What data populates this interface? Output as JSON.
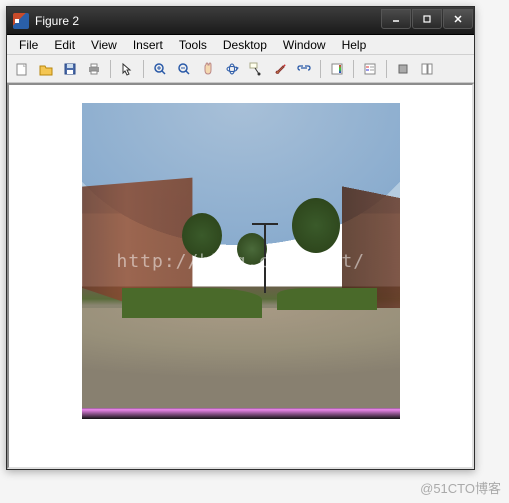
{
  "window": {
    "title": "Figure 2",
    "controls": {
      "minimize": "minimize",
      "maximize": "maximize",
      "close": "close"
    }
  },
  "menubar": {
    "items": [
      "File",
      "Edit",
      "View",
      "Insert",
      "Tools",
      "Desktop",
      "Window",
      "Help"
    ]
  },
  "toolbar": {
    "groups": [
      [
        "new-figure",
        "open",
        "save",
        "print"
      ],
      [
        "arrow"
      ],
      [
        "zoom-in",
        "zoom-out",
        "pan",
        "rotate3d",
        "data-cursor",
        "brush",
        "link"
      ],
      [
        "insert-colorbar",
        "insert-legend"
      ],
      [
        "hide-tools",
        "show-tools"
      ]
    ],
    "icons": {
      "new-figure": "new-figure-icon",
      "open": "open-icon",
      "save": "save-icon",
      "print": "print-icon",
      "arrow": "arrow-icon",
      "zoom-in": "zoom-in-icon",
      "zoom-out": "zoom-out-icon",
      "pan": "pan-icon",
      "rotate3d": "rotate3d-icon",
      "data-cursor": "data-cursor-icon",
      "brush": "brush-icon",
      "link": "link-icon",
      "insert-colorbar": "colorbar-icon",
      "insert-legend": "legend-icon",
      "hide-tools": "hide-tools-icon",
      "show-tools": "show-tools-icon"
    }
  },
  "figure": {
    "watermark": "http://blog.csdn.net/",
    "scene": "outdoor-campus-panorama"
  },
  "credit": "@51CTO博客"
}
